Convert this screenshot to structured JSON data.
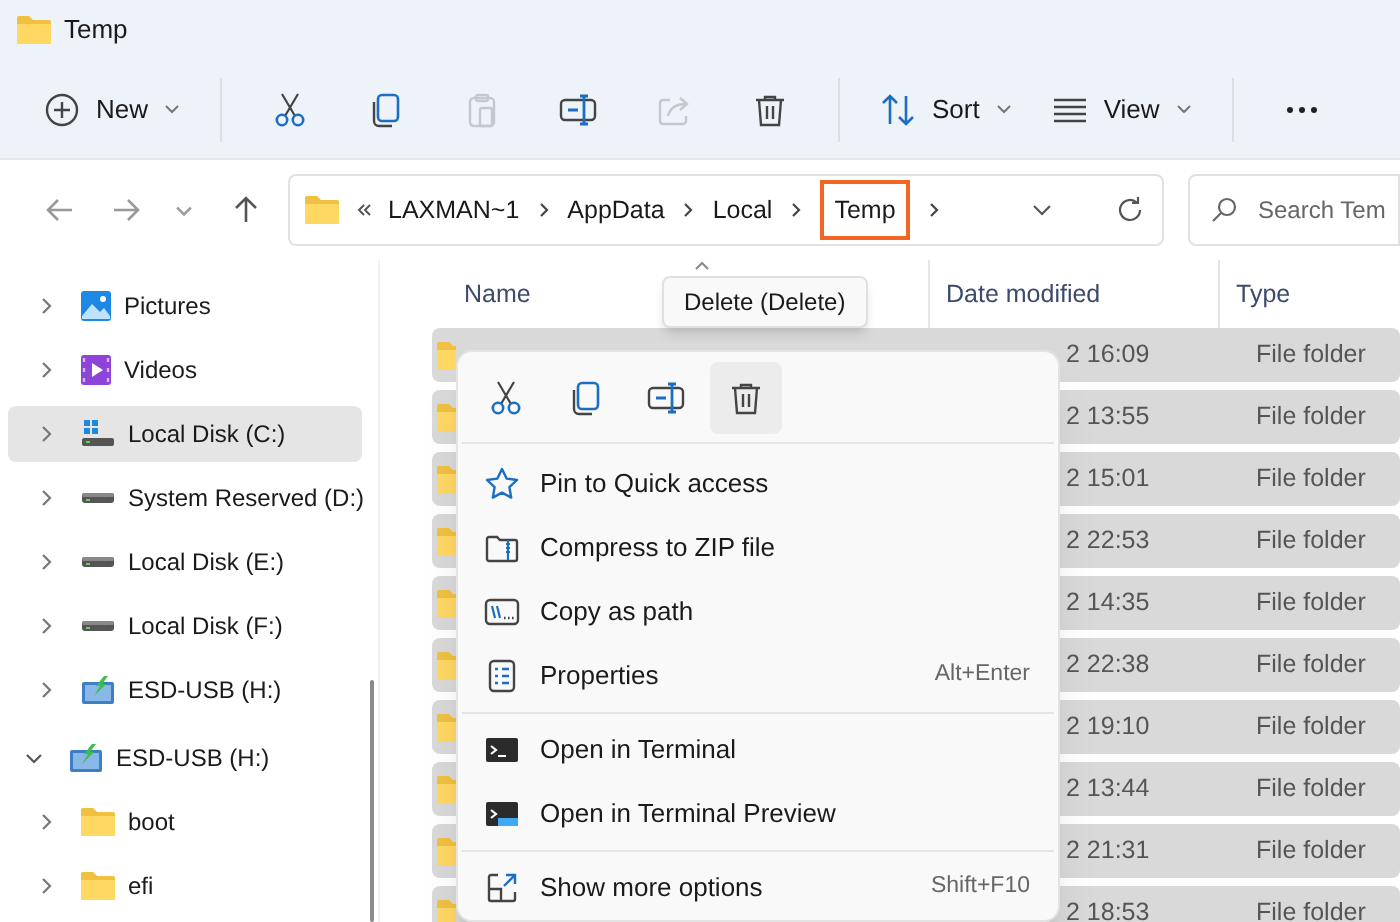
{
  "window": {
    "title": "Temp"
  },
  "toolbar": {
    "items": [
      {
        "kind": "new",
        "label": "New",
        "dropdown": true
      },
      {
        "kind": "separator"
      },
      {
        "kind": "cut",
        "disabled": false
      },
      {
        "kind": "copy",
        "disabled": false
      },
      {
        "kind": "paste",
        "disabled": true
      },
      {
        "kind": "rename",
        "disabled": false
      },
      {
        "kind": "share",
        "disabled": true
      },
      {
        "kind": "delete",
        "disabled": false
      },
      {
        "kind": "separator"
      },
      {
        "kind": "sort",
        "label": "Sort",
        "dropdown": true
      },
      {
        "kind": "view",
        "label": "View",
        "dropdown": true
      },
      {
        "kind": "separator"
      },
      {
        "kind": "more"
      }
    ]
  },
  "address_bar": {
    "segments": [
      {
        "label": "LAXMAN~1",
        "highlighted": false
      },
      {
        "label": "AppData",
        "highlighted": false
      },
      {
        "label": "Local",
        "highlighted": false
      },
      {
        "label": "Temp",
        "highlighted": true
      }
    ],
    "search": {
      "placeholder": "Search Tem"
    }
  },
  "nav": {
    "items": [
      {
        "label": "Pictures",
        "kind": "pictures",
        "selected": false
      },
      {
        "label": "Videos",
        "kind": "videos",
        "selected": false
      },
      {
        "label": "Local Disk (C:)",
        "kind": "system-drive",
        "selected": true
      },
      {
        "label": "System Reserved (D:)",
        "kind": "drive",
        "selected": false
      },
      {
        "label": "Local Disk (E:)",
        "kind": "drive",
        "selected": false
      },
      {
        "label": "Local Disk (F:)",
        "kind": "drive",
        "selected": false
      },
      {
        "label": "ESD-USB (H:)",
        "kind": "usb-drive",
        "selected": false
      }
    ],
    "tree": {
      "label": "ESD-USB (H:)",
      "kind": "usb-drive",
      "expanded": true,
      "selected": false,
      "children": [
        {
          "label": "boot",
          "kind": "folder",
          "expanded": false,
          "selected": false
        },
        {
          "label": "efi",
          "kind": "folder",
          "expanded": false,
          "selected": false
        }
      ]
    }
  },
  "file_list": {
    "columns": [
      "Name",
      "Date modified",
      "Type"
    ],
    "rows": [
      {
        "date": "2 16:09",
        "type": "File folder",
        "selected": true
      },
      {
        "date": "2 13:55",
        "type": "File folder",
        "selected": true
      },
      {
        "date": "2 15:01",
        "type": "File folder",
        "selected": true
      },
      {
        "date": "2 22:53",
        "type": "File folder",
        "selected": true
      },
      {
        "date": "2 14:35",
        "type": "File folder",
        "selected": true
      },
      {
        "date": "2 22:38",
        "type": "File folder",
        "selected": true
      },
      {
        "date": "2 19:10",
        "type": "File folder",
        "selected": true
      },
      {
        "date": "2 13:44",
        "type": "File folder",
        "selected": true
      },
      {
        "date": "2 21:31",
        "type": "File folder",
        "selected": true
      },
      {
        "date": "2 18:53",
        "type": "File folder",
        "selected": true
      }
    ]
  },
  "tooltip": "Delete (Delete)",
  "context_menu": {
    "actions": [
      {
        "kind": "cut",
        "hovered": false
      },
      {
        "kind": "copy",
        "hovered": false
      },
      {
        "kind": "rename",
        "hovered": false
      },
      {
        "kind": "delete",
        "hovered": true
      }
    ],
    "items": [
      {
        "kind": "pin",
        "label": "Pin to Quick access"
      },
      {
        "kind": "zip",
        "label": "Compress to ZIP file"
      },
      {
        "kind": "path",
        "label": "Copy as path"
      },
      {
        "kind": "properties",
        "label": "Properties",
        "shortcut": "Alt+Enter"
      },
      {
        "kind": "separator"
      },
      {
        "kind": "terminal",
        "label": "Open in Terminal"
      },
      {
        "kind": "terminal-preview",
        "label": "Open in Terminal Preview"
      },
      {
        "kind": "separator"
      },
      {
        "kind": "more-options",
        "label": "Show more options",
        "shortcut": "Shift+F10"
      }
    ]
  }
}
